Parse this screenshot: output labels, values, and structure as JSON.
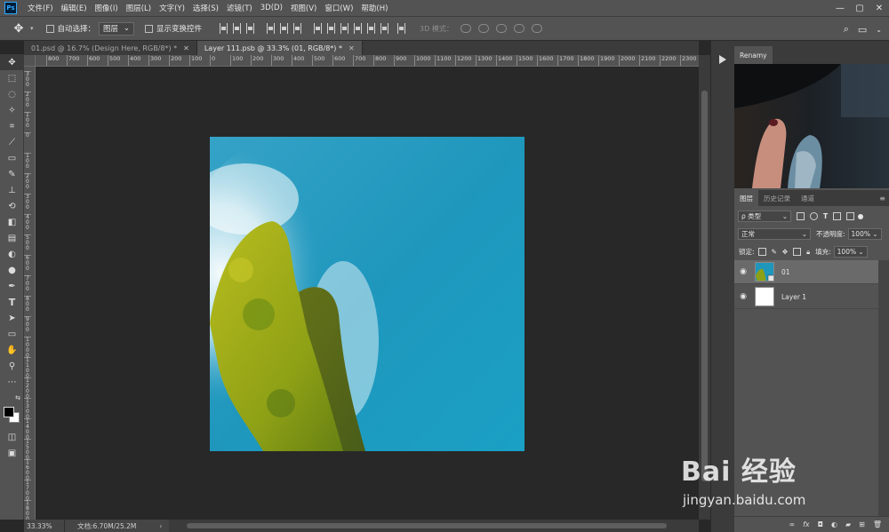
{
  "app": {
    "logo_text": "Ps"
  },
  "menu": [
    "文件(F)",
    "编辑(E)",
    "图像(I)",
    "图层(L)",
    "文字(Y)",
    "选择(S)",
    "滤镜(T)",
    "3D(D)",
    "视图(V)",
    "窗口(W)",
    "帮助(H)"
  ],
  "window_controls": {
    "minimize": "—",
    "maximize": "▢",
    "close": "✕"
  },
  "options": {
    "auto_select_label": "自动选择：",
    "auto_select_value": "图层",
    "show_transform_label": "显示变换控件",
    "mode_3d_label": "3D 模式："
  },
  "tabs": [
    {
      "label": "01.psd @ 16.7% (Design Here, RGB/8*) *",
      "close": "✕",
      "active": false
    },
    {
      "label": "Layer 111.psb @ 33.3% (01, RGB/8*) *",
      "close": "✕",
      "active": true
    }
  ],
  "ruler_top": [
    "800",
    "700",
    "600",
    "500",
    "400",
    "300",
    "200",
    "100",
    "0",
    "100",
    "200",
    "300",
    "400",
    "500",
    "600",
    "700",
    "800",
    "900",
    "1000",
    "1100",
    "1200",
    "1300",
    "1400",
    "1500",
    "1600",
    "1700",
    "1800",
    "1900",
    "2000",
    "2100",
    "2200",
    "2300"
  ],
  "ruler_left": [
    "300",
    "200",
    "100",
    "0",
    "100",
    "200",
    "300",
    "400",
    "500",
    "600",
    "700",
    "800",
    "900",
    "1000",
    "1100",
    "1200",
    "1300",
    "1400",
    "1500",
    "1600",
    "1700",
    "1800"
  ],
  "status": {
    "zoom": "33.33%",
    "doc": "文档:6.70M/25.2M",
    "arrow": "›"
  },
  "right_panel": {
    "preview_tab": "Renamy",
    "layer_tabs": [
      "图层",
      "历史记录",
      "通道"
    ],
    "filter_label": "ρ 类型",
    "blend_mode": "正常",
    "opacity_label": "不透明度:",
    "opacity_value": "100%",
    "lock_label": "锁定:",
    "fill_label": "填充:",
    "fill_value": "100%",
    "layers": [
      {
        "name": "01",
        "selected": true
      },
      {
        "name": "Layer 1",
        "selected": false
      }
    ]
  },
  "watermark": {
    "brand": "Bai 经验",
    "url": "jingyan.baidu.com"
  }
}
